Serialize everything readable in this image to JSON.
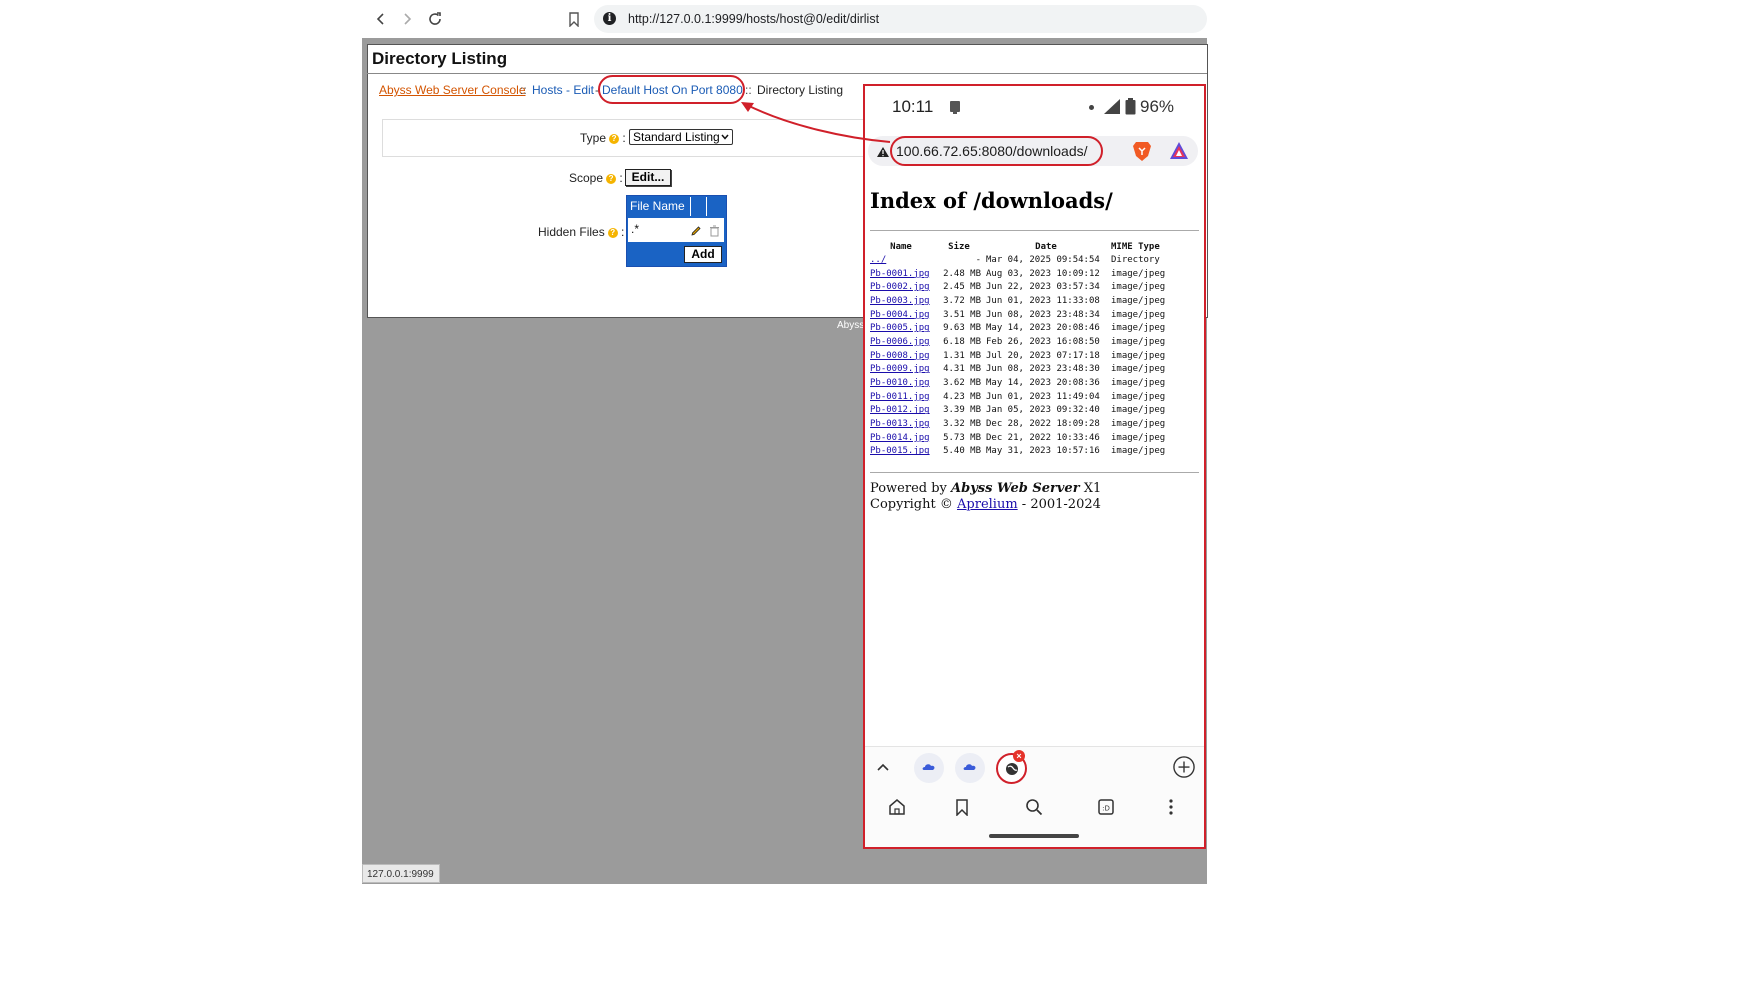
{
  "browser": {
    "url": "http://127.0.0.1:9999/hosts/host@0/edit/dirlist",
    "status_url": "127.0.0.1:9999"
  },
  "console": {
    "title": "Directory Listing",
    "breadcrumb": {
      "root": "Abyss Web Server Console",
      "sep1": "::",
      "hosts_edit": "Hosts - Edit",
      "dash": "-",
      "host": "Default Host On Port 8080",
      "sep2": "::",
      "current": "Directory Listing"
    },
    "form": {
      "type_label": "Type",
      "type_value": "Standard Listing",
      "scope_label": "Scope",
      "scope_button": "Edit...",
      "hidden_label": "Hidden Files",
      "colon": ":",
      "table_header": "File Name",
      "hidden_value": ".*",
      "add_button": "Add"
    },
    "footer_fragment": "Abyss"
  },
  "phone": {
    "time": "10:11",
    "battery": "96%",
    "url": "100.66.72.65:8080/downloads/",
    "heading": "Index of /downloads/",
    "columns": [
      "Name",
      "Size",
      "Date",
      "MIME Type"
    ],
    "rows": [
      {
        "name": "../",
        "size": "-",
        "date": "Mar 04, 2025 09:54:54",
        "type": "Directory"
      },
      {
        "name": "Pb-0001.jpg",
        "size": "2.48 MB",
        "date": "Aug 03, 2023 10:09:12",
        "type": "image/jpeg"
      },
      {
        "name": "Pb-0002.jpg",
        "size": "2.45 MB",
        "date": "Jun 22, 2023 03:57:34",
        "type": "image/jpeg"
      },
      {
        "name": "Pb-0003.jpg",
        "size": "3.72 MB",
        "date": "Jun 01, 2023 11:33:08",
        "type": "image/jpeg"
      },
      {
        "name": "Pb-0004.jpg",
        "size": "3.51 MB",
        "date": "Jun 08, 2023 23:48:34",
        "type": "image/jpeg"
      },
      {
        "name": "Pb-0005.jpg",
        "size": "9.63 MB",
        "date": "May 14, 2023 20:08:46",
        "type": "image/jpeg"
      },
      {
        "name": "Pb-0006.jpg",
        "size": "6.18 MB",
        "date": "Feb 26, 2023 16:08:50",
        "type": "image/jpeg"
      },
      {
        "name": "Pb-0008.jpg",
        "size": "1.31 MB",
        "date": "Jul 20, 2023 07:17:18",
        "type": "image/jpeg"
      },
      {
        "name": "Pb-0009.jpg",
        "size": "4.31 MB",
        "date": "Jun 08, 2023 23:48:30",
        "type": "image/jpeg"
      },
      {
        "name": "Pb-0010.jpg",
        "size": "3.62 MB",
        "date": "May 14, 2023 20:08:36",
        "type": "image/jpeg"
      },
      {
        "name": "Pb-0011.jpg",
        "size": "4.23 MB",
        "date": "Jun 01, 2023 11:49:04",
        "type": "image/jpeg"
      },
      {
        "name": "Pb-0012.jpg",
        "size": "3.39 MB",
        "date": "Jan 05, 2023 09:32:40",
        "type": "image/jpeg"
      },
      {
        "name": "Pb-0013.jpg",
        "size": "3.32 MB",
        "date": "Dec 28, 2022 18:09:28",
        "type": "image/jpeg"
      },
      {
        "name": "Pb-0014.jpg",
        "size": "5.73 MB",
        "date": "Dec 21, 2022 10:33:46",
        "type": "image/jpeg"
      },
      {
        "name": "Pb-0015.jpg",
        "size": "5.40 MB",
        "date": "May 31, 2023 10:57:16",
        "type": "image/jpeg"
      }
    ],
    "powered_prefix": "Powered by",
    "powered_name": "Abyss Web Server",
    "powered_suffix": "X1",
    "copyright_prefix": "Copyright ©",
    "copyright_link": "Aprelium",
    "copyright_suffix": "- 2001-2024"
  },
  "colors": {
    "annotation": "#d0202a",
    "link_blue": "#1a5bb5",
    "console_orange": "#d35400",
    "table_blue": "#1a63c4"
  }
}
